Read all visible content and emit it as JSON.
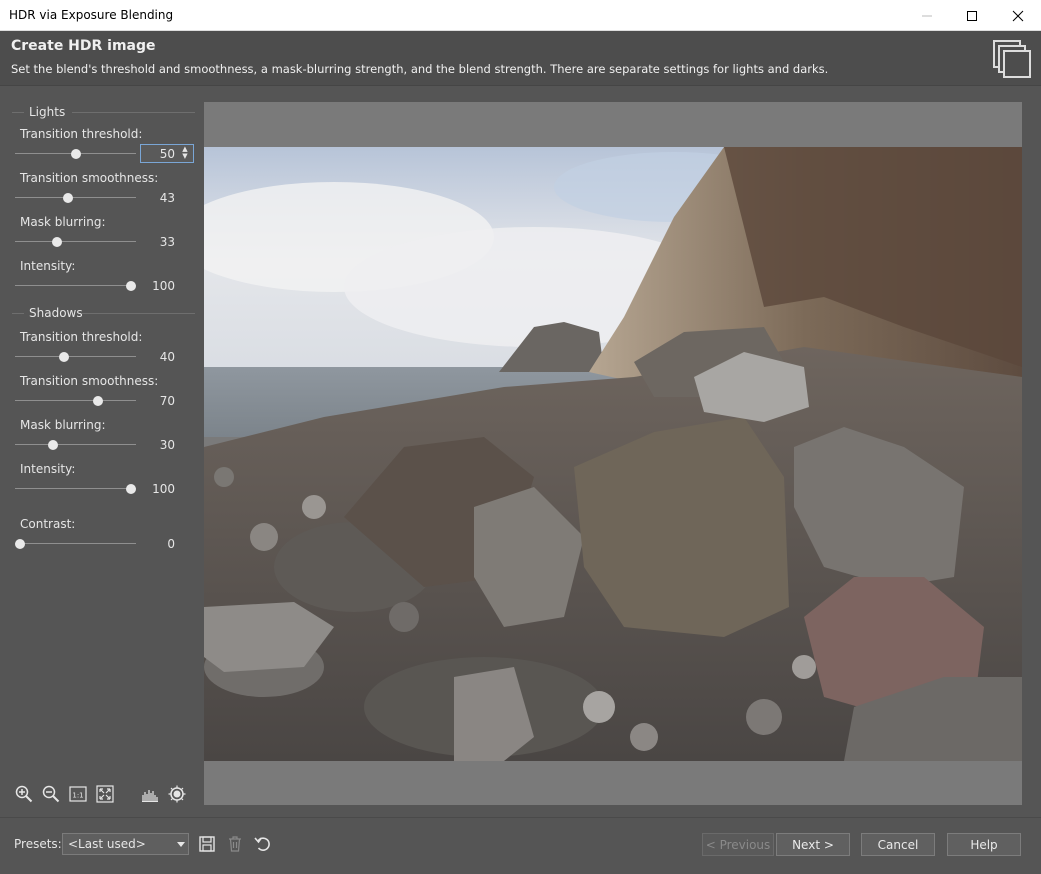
{
  "window": {
    "title": "HDR via Exposure Blending"
  },
  "header": {
    "title": "Create HDR image",
    "description": "Set the blend's threshold and smoothness, a mask-blurring strength, and the blend strength. There are separate settings for lights and darks."
  },
  "lights": {
    "heading": "Lights",
    "threshold": {
      "label": "Transition threshold:",
      "value": "50",
      "level": 0.5
    },
    "smoothness": {
      "label": "Transition smoothness:",
      "value": "43",
      "level": 0.43
    },
    "blur": {
      "label": "Mask blurring:",
      "value": "33",
      "level": 0.33
    },
    "intensity": {
      "label": "Intensity:",
      "value": "100",
      "level": 1.0
    }
  },
  "shadows": {
    "heading": "Shadows",
    "threshold": {
      "label": "Transition threshold:",
      "value": "40",
      "level": 0.4
    },
    "smoothness": {
      "label": "Transition smoothness:",
      "value": "70",
      "level": 0.7
    },
    "blur": {
      "label": "Mask blurring:",
      "value": "30",
      "level": 0.3
    },
    "intensity": {
      "label": "Intensity:",
      "value": "100",
      "level": 1.0
    }
  },
  "contrast": {
    "label": "Contrast:",
    "value": "0",
    "level": 0.0
  },
  "toolbar_icons": [
    "zoom-in-icon",
    "zoom-out-icon",
    "actual-size-icon",
    "fit-to-window-icon",
    "histogram-icon",
    "preview-toggle-icon"
  ],
  "footer": {
    "presets_label": "Presets:",
    "presets_value": "<Last used>",
    "previous": "< Previous",
    "next": "Next >",
    "cancel": "Cancel",
    "help": "Help"
  },
  "colors": {
    "panel": "#555555",
    "header": "#4d4d4d",
    "preview_bg": "#7a7a7a",
    "focus": "#7aa6d6"
  }
}
